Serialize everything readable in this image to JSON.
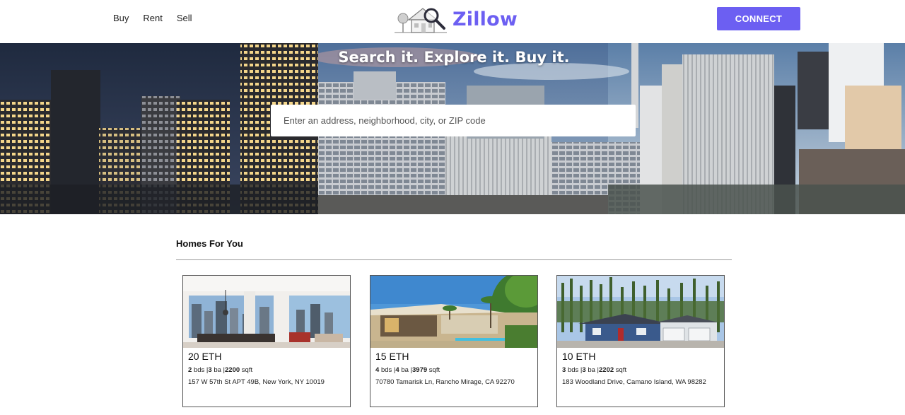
{
  "nav": {
    "items": [
      {
        "label": "Buy"
      },
      {
        "label": "Rent"
      },
      {
        "label": "Sell"
      }
    ]
  },
  "brand": {
    "name": "Zillow",
    "color": "#6c5ff2"
  },
  "header": {
    "connect_label": "CONNECT"
  },
  "hero": {
    "title": "Search it. Explore it. Buy it.",
    "search_placeholder": "Enter an address, neighborhood, city, or ZIP code"
  },
  "listings": {
    "heading": "Homes For You",
    "items": [
      {
        "price": "20 ETH",
        "beds": "2",
        "beds_unit": "bds",
        "baths": "3",
        "baths_unit": "ba",
        "sqft": "2200",
        "sqft_unit": "sqft",
        "address": "157 W 57th St APT 49B, New York, NY 10019"
      },
      {
        "price": "15 ETH",
        "beds": "4",
        "beds_unit": "bds",
        "baths": "4",
        "baths_unit": "ba",
        "sqft": "3979",
        "sqft_unit": "sqft",
        "address": "70780 Tamarisk Ln, Rancho Mirage, CA 92270"
      },
      {
        "price": "10 ETH",
        "beds": "3",
        "beds_unit": "bds",
        "baths": "3",
        "baths_unit": "ba",
        "sqft": "2202",
        "sqft_unit": "sqft",
        "address": "183 Woodland Drive, Camano Island, WA 98282"
      }
    ]
  }
}
